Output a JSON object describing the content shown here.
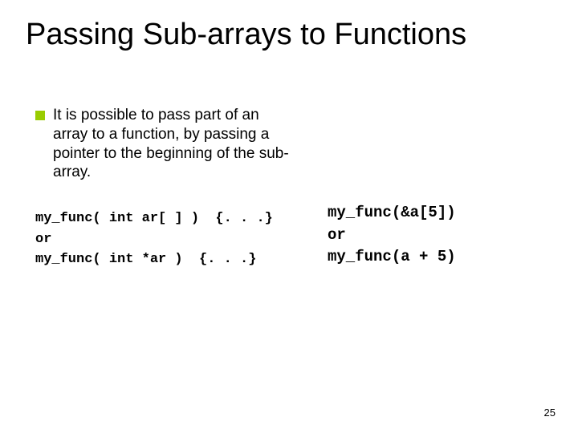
{
  "title": "Passing Sub-arrays to Functions",
  "bullet": {
    "text": "It is possible to pass part of an array to a function, by passing a pointer to the beginning of the sub-array."
  },
  "code_left": "my_func( int ar[ ] )  {. . .}\nor\nmy_func( int *ar )  {. . .}",
  "code_right": "my_func(&a[5])\nor\nmy_func(a + 5)",
  "page_number": "25"
}
